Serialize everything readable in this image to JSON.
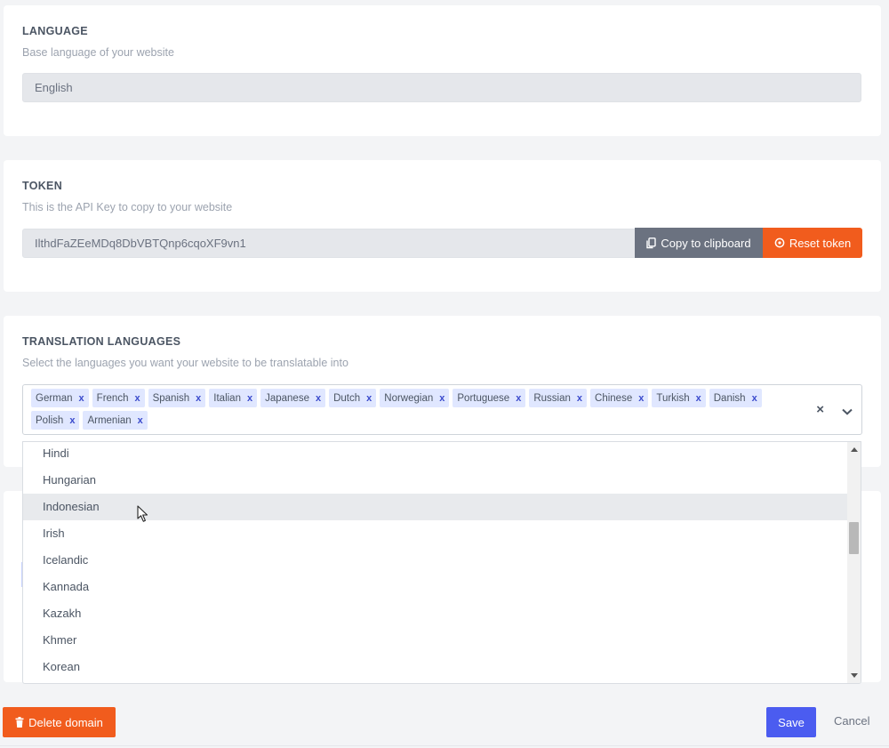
{
  "language": {
    "title": "LANGUAGE",
    "description": "Base language of your website",
    "value": "English"
  },
  "token": {
    "title": "TOKEN",
    "description": "This is the API Key to copy to your website",
    "value": "IlthdFaZEeMDq8DbVBTQnp6cqoXF9vn1",
    "copy_label": "Copy to clipboard",
    "reset_label": "Reset token"
  },
  "translation": {
    "title": "TRANSLATION LANGUAGES",
    "description": "Select the languages you want your website to be translatable into",
    "selected": [
      "German",
      "French",
      "Spanish",
      "Italian",
      "Japanese",
      "Dutch",
      "Norwegian",
      "Portuguese",
      "Russian",
      "Chinese",
      "Turkish",
      "Danish",
      "Polish",
      "Armenian"
    ],
    "remove_glyph": "x",
    "clear_glyph": "×",
    "options": [
      "Hindi",
      "Hungarian",
      "Indonesian",
      "Irish",
      "Icelandic",
      "Kannada",
      "Kazakh",
      "Khmer",
      "Korean"
    ],
    "highlighted_option": "Indonesian"
  },
  "footer": {
    "delete_label": "Delete domain",
    "save_label": "Save",
    "cancel_label": "Cancel"
  },
  "colors": {
    "accent_orange": "#f15c1d",
    "accent_blue": "#4b5cf0",
    "neutral_button": "#6b7280",
    "tag_bg": "#e0e7ff"
  }
}
